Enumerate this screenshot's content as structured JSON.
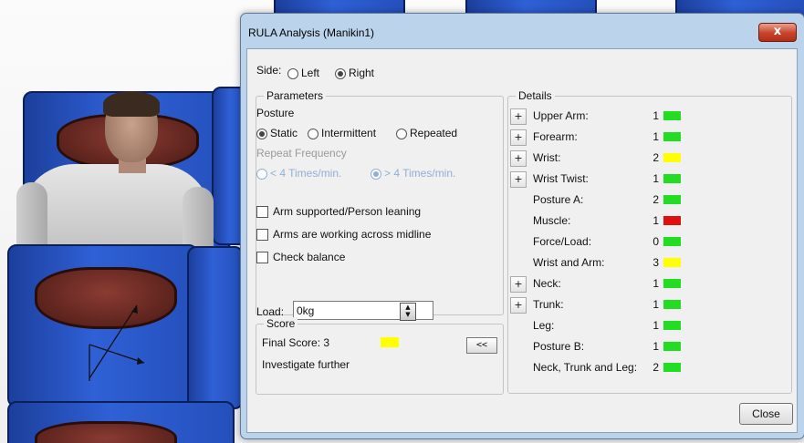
{
  "dialog": {
    "title": "RULA Analysis (Manikin1)",
    "close_glyph": "x",
    "side_label": "Side:",
    "side_options": [
      "Left",
      "Right"
    ],
    "side_selected": "Right"
  },
  "parameters": {
    "group_title": "Parameters",
    "posture_label": "Posture",
    "posture_options": [
      "Static",
      "Intermittent",
      "Repeated"
    ],
    "posture_selected": "Static",
    "repeat_frequency_label": "Repeat Frequency",
    "repeat_options": [
      "< 4 Times/min.",
      "> 4 Times/min."
    ],
    "repeat_selected": "> 4 Times/min.",
    "checkboxes": [
      "Arm supported/Person leaning",
      "Arms are working across midline",
      "Check balance"
    ],
    "load_label": "Load:",
    "load_value": "0kg"
  },
  "score": {
    "group_title": "Score",
    "final_score_text": "Final Score: 3",
    "final_score_color": "#ffff00",
    "verdict": "Investigate further",
    "collapse_label": "<<"
  },
  "details": {
    "group_title": "Details",
    "rows": [
      {
        "label": "Upper Arm:",
        "value": "1",
        "color": "#22dd22",
        "expandable": true
      },
      {
        "label": "Forearm:",
        "value": "1",
        "color": "#22dd22",
        "expandable": true
      },
      {
        "label": "Wrist:",
        "value": "2",
        "color": "#ffff00",
        "expandable": true
      },
      {
        "label": "Wrist Twist:",
        "value": "1",
        "color": "#22dd22",
        "expandable": true
      },
      {
        "label": "Posture A:",
        "value": "2",
        "color": "#22dd22",
        "expandable": false
      },
      {
        "label": "Muscle:",
        "value": "1",
        "color": "#e01010",
        "expandable": false
      },
      {
        "label": "Force/Load:",
        "value": "0",
        "color": "#22dd22",
        "expandable": false
      },
      {
        "label": "Wrist and Arm:",
        "value": "3",
        "color": "#ffff00",
        "expandable": false
      },
      {
        "label": "Neck:",
        "value": "1",
        "color": "#22dd22",
        "expandable": true
      },
      {
        "label": "Trunk:",
        "value": "1",
        "color": "#22dd22",
        "expandable": true
      },
      {
        "label": "Leg:",
        "value": "1",
        "color": "#22dd22",
        "expandable": false
      },
      {
        "label": "Posture B:",
        "value": "1",
        "color": "#22dd22",
        "expandable": false
      },
      {
        "label": "Neck, Trunk and Leg:",
        "value": "2",
        "color": "#22dd22",
        "expandable": false
      }
    ],
    "expand_glyph": "+"
  },
  "footer": {
    "close_label": "Close"
  }
}
